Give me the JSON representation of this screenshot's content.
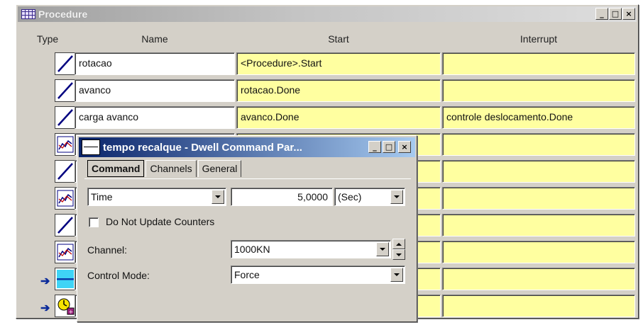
{
  "window": {
    "title": "Procedure",
    "controls": {
      "minimize": "_",
      "maximize": "□",
      "close": "×"
    }
  },
  "columns": {
    "type": "Type",
    "name": "Name",
    "start": "Start",
    "interrupt": "Interrupt"
  },
  "rows": [
    {
      "icon": "ramp-icon",
      "name": "rotacao",
      "start": "<Procedure>.Start",
      "interrupt": ""
    },
    {
      "icon": "ramp-icon",
      "name": "avanco",
      "start": "rotacao.Done",
      "interrupt": ""
    },
    {
      "icon": "ramp-icon",
      "name": "carga avanco",
      "start": "avanco.Done",
      "interrupt": "controle deslocamento.Done"
    },
    {
      "icon": "data-acquisition-icon",
      "name": "",
      "start": "",
      "interrupt": ""
    },
    {
      "icon": "ramp-icon",
      "name": "",
      "start": "",
      "interrupt": ""
    },
    {
      "icon": "data-acquisition-icon",
      "name": "",
      "start": "",
      "interrupt": ""
    },
    {
      "icon": "ramp-icon",
      "name": "",
      "start": "",
      "interrupt": ""
    },
    {
      "icon": "data-acquisition-icon",
      "name": "",
      "start": "",
      "interrupt": ""
    },
    {
      "icon": "dwell-icon",
      "name": "",
      "start": "",
      "interrupt": "",
      "current": true
    },
    {
      "icon": "timer-icon",
      "name": "",
      "start": "",
      "interrupt": "",
      "current": true
    }
  ],
  "dialog": {
    "title": "tempo recalque - Dwell Command Par...",
    "controls": {
      "minimize": "_",
      "maximize": "□",
      "close": "×"
    },
    "tabs": [
      "Command",
      "Channels",
      "General"
    ],
    "active_tab": "Command",
    "dwell_type": "Time",
    "duration_value": "5,0000",
    "duration_unit": "(Sec)",
    "do_not_update_counters_label": "Do Not Update Counters",
    "do_not_update_counters_checked": false,
    "channel_label": "Channel:",
    "channel_value": "1000KN",
    "control_mode_label": "Control Mode:",
    "control_mode_value": "Force"
  }
}
